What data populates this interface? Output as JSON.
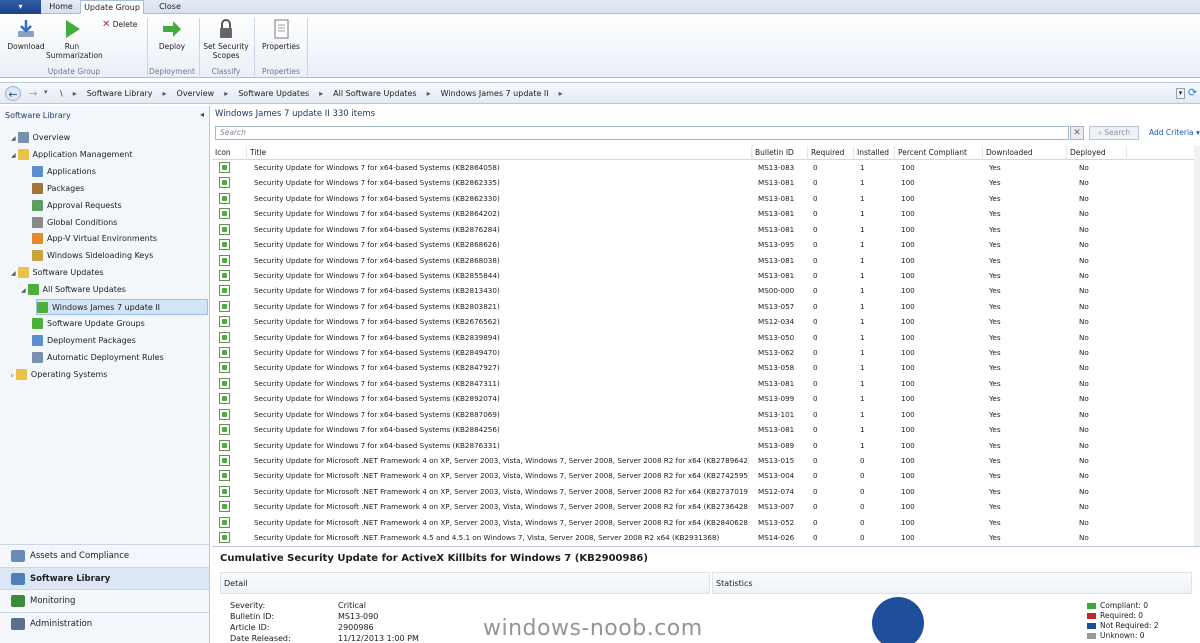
{
  "tabs": {
    "file": "▾",
    "home": "Home",
    "update_group": "Update Group",
    "close": "Close"
  },
  "ribbon": {
    "download": "Download",
    "run_summarization": "Run Summarization",
    "delete": "Delete",
    "deploy": "Deploy",
    "set_security_scopes": "Set Security Scopes",
    "properties": "Properties",
    "group_update_group": "Update Group",
    "group_deployment": "Deployment",
    "group_classify": "Classify",
    "group_properties": "Properties"
  },
  "breadcrumb": [
    "\\",
    "Software Library",
    "Overview",
    "Software Updates",
    "All Software Updates",
    "Windows James 7 update II"
  ],
  "nav": {
    "title": "Software Library",
    "tree": [
      {
        "label": "Overview",
        "indent": 1,
        "icon": "overview-icon",
        "color": "#7a8fb0"
      },
      {
        "label": "Application Management",
        "indent": 1,
        "icon": "folder-icon",
        "color": "#e8c24a"
      },
      {
        "label": "Applications",
        "indent": 2,
        "icon": "applications-icon",
        "color": "#5b8fd1"
      },
      {
        "label": "Packages",
        "indent": 2,
        "icon": "packages-icon",
        "color": "#a2743a"
      },
      {
        "label": "Approval Requests",
        "indent": 2,
        "icon": "approval-icon",
        "color": "#5c9e5c"
      },
      {
        "label": "Global Conditions",
        "indent": 2,
        "icon": "conditions-icon",
        "color": "#8a8a8a"
      },
      {
        "label": "App-V Virtual Environments",
        "indent": 2,
        "icon": "appv-icon",
        "color": "#e18b2c"
      },
      {
        "label": "Windows Sideloading Keys",
        "indent": 2,
        "icon": "keys-icon",
        "color": "#c9a43a"
      },
      {
        "label": "Software Updates",
        "indent": 1,
        "icon": "folder-icon",
        "color": "#e8c24a"
      },
      {
        "label": "All Software Updates",
        "indent": 2,
        "icon": "updates-icon",
        "color": "#4caf3a"
      },
      {
        "label": "Windows James 7 update II",
        "indent": 3,
        "icon": "update-group-icon",
        "color": "#4caf3a",
        "selected": true
      },
      {
        "label": "Software Update Groups",
        "indent": 2,
        "icon": "update-groups-icon",
        "color": "#4caf3a"
      },
      {
        "label": "Deployment Packages",
        "indent": 2,
        "icon": "deployment-packages-icon",
        "color": "#5b8fd1"
      },
      {
        "label": "Automatic Deployment Rules",
        "indent": 2,
        "icon": "rules-icon",
        "color": "#7a8fb0"
      },
      {
        "label": "Operating Systems",
        "indent": 1,
        "icon": "folder-icon",
        "color": "#e8c24a"
      }
    ],
    "workspaces": [
      {
        "label": "Assets and Compliance",
        "color": "#6a8ab8"
      },
      {
        "label": "Software Library",
        "color": "#4f7fb8",
        "selected": true
      },
      {
        "label": "Monitoring",
        "color": "#3c8a3c"
      },
      {
        "label": "Administration",
        "color": "#5a6f8f"
      }
    ]
  },
  "list": {
    "header": "Windows James 7 update II 330 items",
    "search_placeholder": "Search",
    "search_button": "Search",
    "add_criteria": "Add Criteria ▾",
    "columns": [
      "Icon",
      "Title",
      "Bulletin ID",
      "Required",
      "Installed",
      "Percent Compliant",
      "Downloaded",
      "Deployed"
    ],
    "rows": [
      [
        "Security Update for Windows 7 for x64-based Systems (KB2864058)",
        "MS13-083",
        "0",
        "1",
        "100",
        "Yes",
        "No"
      ],
      [
        "Security Update for Windows 7 for x64-based Systems (KB2862335)",
        "MS13-081",
        "0",
        "1",
        "100",
        "Yes",
        "No"
      ],
      [
        "Security Update for Windows 7 for x64-based Systems (KB2862330)",
        "MS13-081",
        "0",
        "1",
        "100",
        "Yes",
        "No"
      ],
      [
        "Security Update for Windows 7 for x64-based Systems (KB2864202)",
        "MS13-081",
        "0",
        "1",
        "100",
        "Yes",
        "No"
      ],
      [
        "Security Update for Windows 7 for x64-based Systems (KB2876284)",
        "MS13-081",
        "0",
        "1",
        "100",
        "Yes",
        "No"
      ],
      [
        "Security Update for Windows 7 for x64-based Systems (KB2868626)",
        "MS13-095",
        "0",
        "1",
        "100",
        "Yes",
        "No"
      ],
      [
        "Security Update for Windows 7 for x64-based Systems (KB2868038)",
        "MS13-081",
        "0",
        "1",
        "100",
        "Yes",
        "No"
      ],
      [
        "Security Update for Windows 7 for x64-based Systems (KB2855844)",
        "MS13-081",
        "0",
        "1",
        "100",
        "Yes",
        "No"
      ],
      [
        "Security Update for Windows 7 for x64-based Systems (KB2813430)",
        "MS00-000",
        "0",
        "1",
        "100",
        "Yes",
        "No"
      ],
      [
        "Security Update for Windows 7 for x64-based Systems (KB2803821)",
        "MS13-057",
        "0",
        "1",
        "100",
        "Yes",
        "No"
      ],
      [
        "Security Update for Windows 7 for x64-based Systems (KB2676562)",
        "MS12-034",
        "0",
        "1",
        "100",
        "Yes",
        "No"
      ],
      [
        "Security Update for Windows 7 for x64-based Systems (KB2839894)",
        "MS13-050",
        "0",
        "1",
        "100",
        "Yes",
        "No"
      ],
      [
        "Security Update for Windows 7 for x64-based Systems (KB2849470)",
        "MS13-062",
        "0",
        "1",
        "100",
        "Yes",
        "No"
      ],
      [
        "Security Update for Windows 7 for x64-based Systems (KB2847927)",
        "MS13-058",
        "0",
        "1",
        "100",
        "Yes",
        "No"
      ],
      [
        "Security Update for Windows 7 for x64-based Systems (KB2847311)",
        "MS13-081",
        "0",
        "1",
        "100",
        "Yes",
        "No"
      ],
      [
        "Security Update for Windows 7 for x64-based Systems (KB2892074)",
        "MS13-099",
        "0",
        "1",
        "100",
        "Yes",
        "No"
      ],
      [
        "Security Update for Windows 7 for x64-based Systems (KB2887069)",
        "MS13-101",
        "0",
        "1",
        "100",
        "Yes",
        "No"
      ],
      [
        "Security Update for Windows 7 for x64-based Systems (KB2884256)",
        "MS13-081",
        "0",
        "1",
        "100",
        "Yes",
        "No"
      ],
      [
        "Security Update for Windows 7 for x64-based Systems (KB2876331)",
        "MS13-089",
        "0",
        "1",
        "100",
        "Yes",
        "No"
      ],
      [
        "Security Update for Microsoft .NET Framework 4 on XP, Server 2003, Vista, Windows 7, Server 2008, Server 2008 R2 for x64 (KB2789642)",
        "MS13-015",
        "0",
        "0",
        "100",
        "Yes",
        "No"
      ],
      [
        "Security Update for Microsoft .NET Framework 4 on XP, Server 2003, Vista, Windows 7, Server 2008, Server 2008 R2 for x64 (KB2742595)",
        "MS13-004",
        "0",
        "0",
        "100",
        "Yes",
        "No"
      ],
      [
        "Security Update for Microsoft .NET Framework 4 on XP, Server 2003, Vista, Windows 7, Server 2008, Server 2008 R2 for x64 (KB2737019)",
        "MS12-074",
        "0",
        "0",
        "100",
        "Yes",
        "No"
      ],
      [
        "Security Update for Microsoft .NET Framework 4 on XP, Server 2003, Vista, Windows 7, Server 2008, Server 2008 R2 for x64 (KB2736428)",
        "MS13-007",
        "0",
        "0",
        "100",
        "Yes",
        "No"
      ],
      [
        "Security Update for Microsoft .NET Framework 4 on XP, Server 2003, Vista, Windows 7, Server 2008, Server 2008 R2 for x64 (KB2840628)",
        "MS13-052",
        "0",
        "0",
        "100",
        "Yes",
        "No"
      ],
      [
        "Security Update for Microsoft .NET Framework 4.5 and 4.5.1 on Windows 7, Vista, Server 2008, Server 2008 R2 x64 (KB2931368)",
        "MS14-026",
        "0",
        "0",
        "100",
        "Yes",
        "No"
      ]
    ]
  },
  "detail": {
    "title": "Cumulative Security Update for ActiveX Killbits for Windows 7 (KB2900986)",
    "detail_header": "Detail",
    "statistics_header": "Statistics",
    "fields": [
      {
        "label": "Severity:",
        "value": "Critical"
      },
      {
        "label": "Bulletin ID:",
        "value": "MS13-090"
      },
      {
        "label": "Article ID:",
        "value": "2900986"
      },
      {
        "label": "Date Released:",
        "value": "11/12/2013 1:00 PM"
      }
    ],
    "legend": [
      {
        "label": "Compliant: 0",
        "color": "#3aa83a"
      },
      {
        "label": "Required: 0",
        "color": "#c0282d"
      },
      {
        "label": "Not Required: 2",
        "color": "#1f4e9c"
      },
      {
        "label": "Unknown: 0",
        "color": "#9a9a9a"
      }
    ]
  },
  "watermark": "windows-noob.com"
}
